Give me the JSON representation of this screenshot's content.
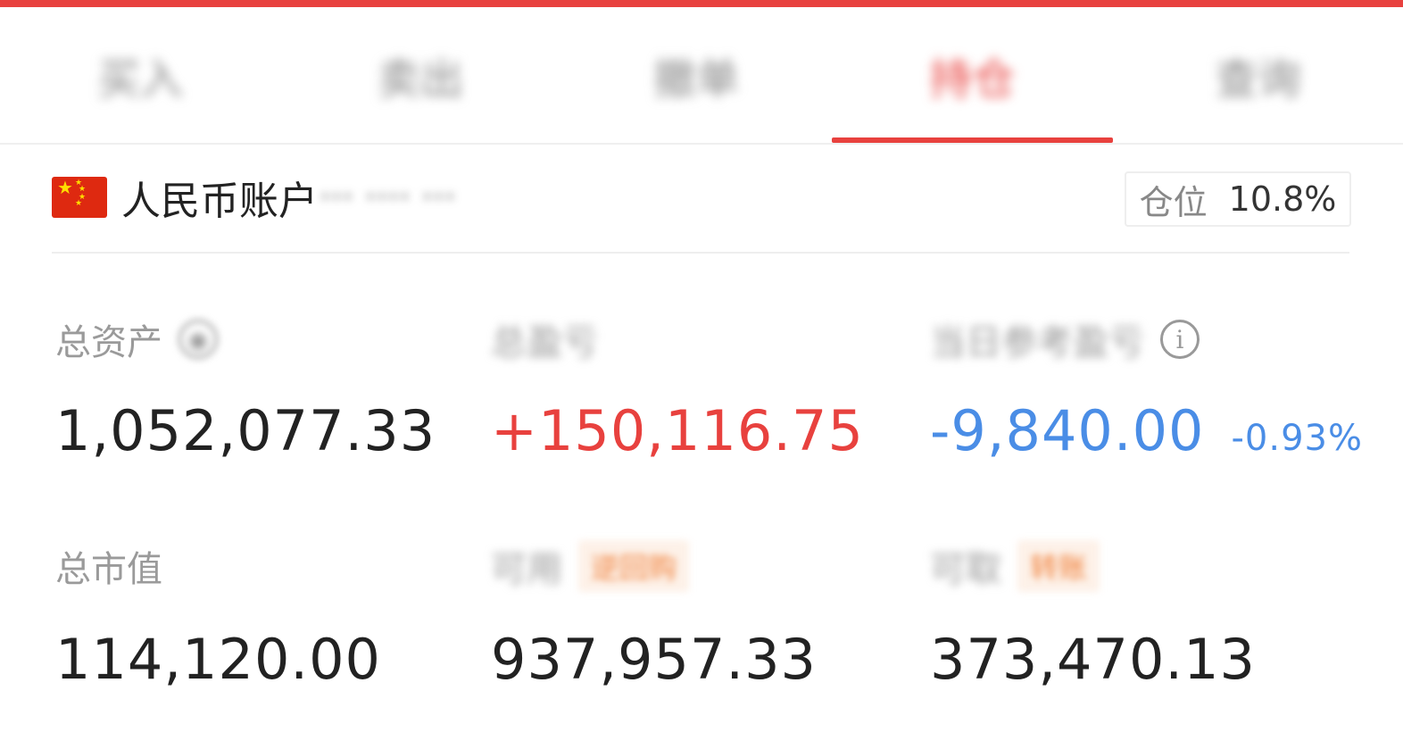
{
  "tabs": [
    {
      "label": "买入",
      "active": false
    },
    {
      "label": "卖出",
      "active": false
    },
    {
      "label": "撤单",
      "active": false
    },
    {
      "label": "持仓",
      "active": true
    },
    {
      "label": "查询",
      "active": false
    }
  ],
  "account": {
    "flag_icon": "china-flag-icon",
    "name": "人民币账户",
    "id_masked": "··· ···· ···",
    "position_label": "仓位",
    "position_value": "10.8%"
  },
  "stats": {
    "total_assets": {
      "label": "总资产",
      "value": "1,052,077.33"
    },
    "total_pnl": {
      "label": "总盈亏",
      "value": "+150,116.75"
    },
    "today_pnl": {
      "label": "当日参考盈亏",
      "value": "-9,840.00",
      "percent": "-0.93%"
    },
    "market_value": {
      "label": "总市值",
      "value": "114,120.00"
    },
    "available": {
      "label": "可用",
      "tag": "逆回购",
      "value": "937,957.33"
    },
    "withdrawable": {
      "label": "可取",
      "tag": "转账",
      "value": "373,470.13"
    }
  },
  "colors": {
    "accent": "#e8413e",
    "positive": "#e8413e",
    "negative": "#4a8de6",
    "tag": "#f0803a"
  }
}
